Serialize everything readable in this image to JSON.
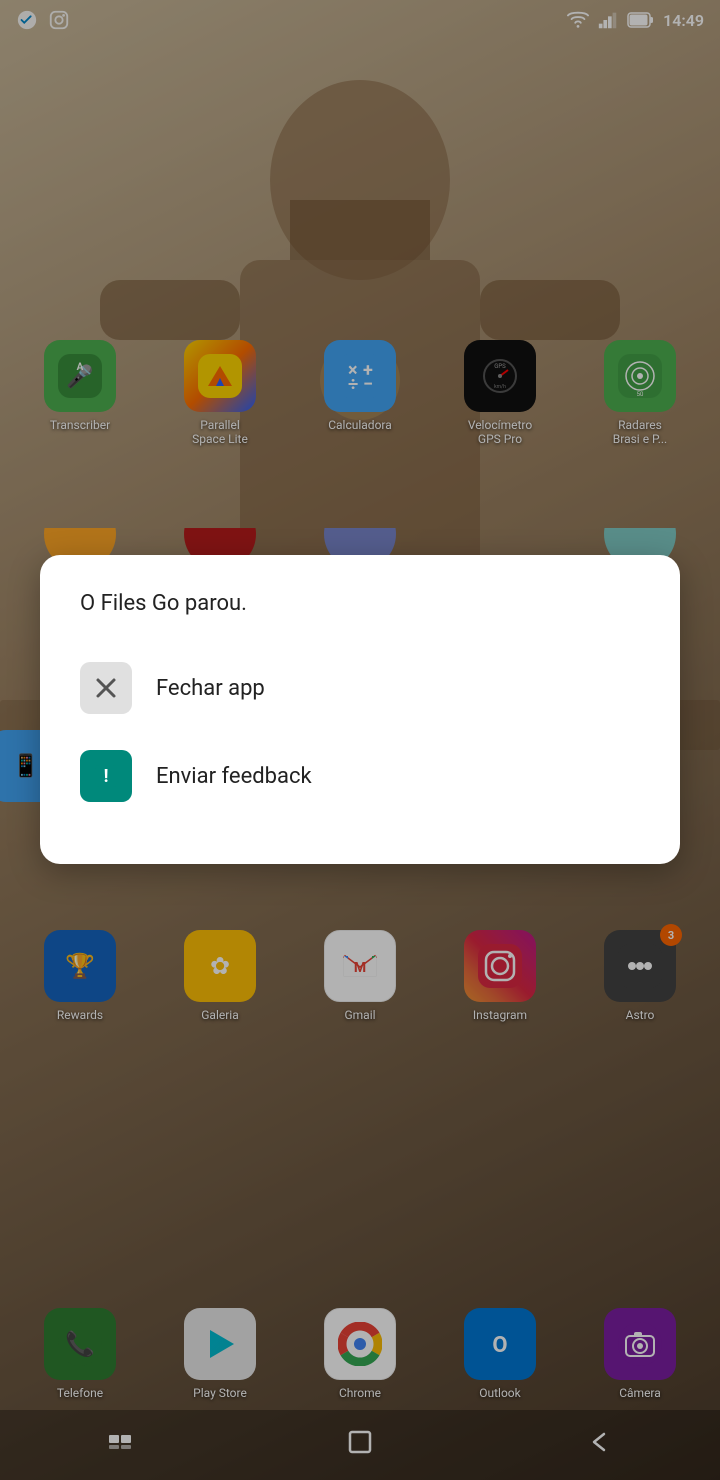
{
  "statusBar": {
    "time": "14:49",
    "icons": [
      "telegram",
      "instagram",
      "wifi",
      "signal",
      "battery"
    ]
  },
  "topApps": [
    {
      "name": "Transcriber",
      "label": "Transcriber",
      "iconType": "transcriber",
      "emoji": "🎤"
    },
    {
      "name": "Parallel Space Lite",
      "label": "Parallel\nSpace Lite",
      "iconType": "parallel",
      "emoji": "▶"
    },
    {
      "name": "Calculadora",
      "label": "Calculadora",
      "iconType": "calc",
      "emoji": "±"
    },
    {
      "name": "Velocímetro GPS Pro",
      "label": "Velocímetro\nGPS Pro",
      "iconType": "speedometer",
      "emoji": "⊙"
    },
    {
      "name": "Radares Brasi e P...",
      "label": "Radares\nBrasi e P...",
      "iconType": "radars",
      "emoji": "📷"
    }
  ],
  "middleApps": [
    {
      "name": "Rewards",
      "label": "Rewards",
      "iconType": "rewards",
      "emoji": "🏆",
      "badge": null
    },
    {
      "name": "Galeria",
      "label": "Galeria",
      "iconType": "galeria",
      "emoji": "✿",
      "badge": null
    },
    {
      "name": "Gmail",
      "label": "Gmail",
      "iconType": "gmail",
      "emoji": "M",
      "badge": null
    },
    {
      "name": "Instagram",
      "label": "Instagram",
      "iconType": "instagram",
      "emoji": "◎",
      "badge": null
    },
    {
      "name": "Astro",
      "label": "Astro",
      "iconType": "astro",
      "emoji": "•••",
      "badge": "3"
    }
  ],
  "dockApps": [
    {
      "name": "Telefone",
      "label": "Telefone",
      "iconType": "phone",
      "emoji": "📞"
    },
    {
      "name": "Play Store",
      "label": "Play Store",
      "iconType": "playstore",
      "emoji": "▶"
    },
    {
      "name": "Chrome",
      "label": "Chrome",
      "iconType": "chrome",
      "emoji": "◎"
    },
    {
      "name": "Outlook",
      "label": "Outlook",
      "iconType": "outlook",
      "emoji": "O"
    },
    {
      "name": "Câmera",
      "label": "Câmera",
      "iconType": "camera",
      "emoji": "📷"
    }
  ],
  "dialog": {
    "title": "O Files Go parou.",
    "options": [
      {
        "id": "close-app",
        "icon": "✕",
        "iconBg": "#E0E0E0",
        "iconColor": "#555",
        "label": "Fechar app"
      },
      {
        "id": "send-feedback",
        "icon": "!",
        "iconBg": "#00897B",
        "iconColor": "white",
        "label": "Enviar feedback"
      }
    ]
  },
  "navBar": {
    "recentIcon": "≡",
    "homeIcon": "□",
    "backIcon": "←"
  }
}
